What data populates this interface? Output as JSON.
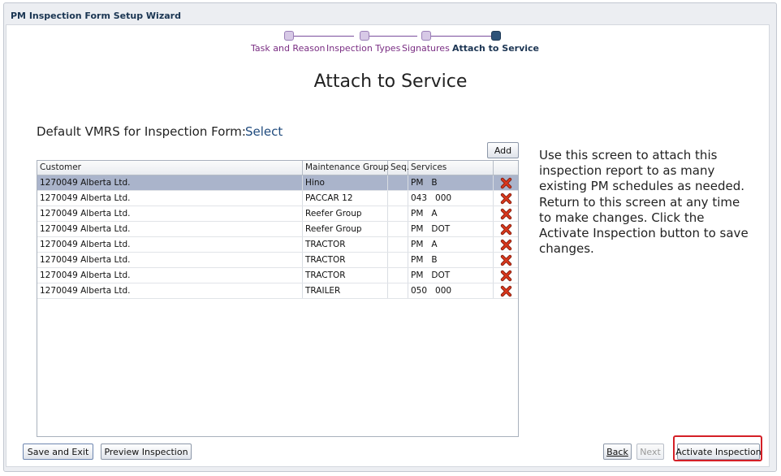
{
  "window": {
    "title": "PM Inspection Form Setup Wizard"
  },
  "wizard": {
    "steps": [
      {
        "label": "Task and Reason",
        "active": false
      },
      {
        "label": "Inspection Types",
        "active": false
      },
      {
        "label": "Signatures",
        "active": false
      },
      {
        "label": "Attach to Service",
        "active": true
      }
    ]
  },
  "page": {
    "heading": "Attach to Service",
    "vmrs_label": "Default VMRS for Inspection Form:",
    "vmrs_link": "Select"
  },
  "table": {
    "add_label": "Add",
    "columns": [
      "Customer",
      "Maintenance Group",
      "Seq.",
      "Services"
    ],
    "rows": [
      {
        "customer": "1270049 Alberta Ltd.",
        "group": "Hino",
        "seq": "",
        "services": "PM   B",
        "selected": true
      },
      {
        "customer": "1270049 Alberta Ltd.",
        "group": "PACCAR 12",
        "seq": "",
        "services": "043   000",
        "selected": false
      },
      {
        "customer": "1270049 Alberta Ltd.",
        "group": "Reefer Group",
        "seq": "",
        "services": "PM   A",
        "selected": false
      },
      {
        "customer": "1270049 Alberta Ltd.",
        "group": "Reefer Group",
        "seq": "",
        "services": "PM   DOT",
        "selected": false
      },
      {
        "customer": "1270049 Alberta Ltd.",
        "group": "TRACTOR",
        "seq": "",
        "services": "PM   A",
        "selected": false
      },
      {
        "customer": "1270049 Alberta Ltd.",
        "group": "TRACTOR",
        "seq": "",
        "services": "PM   B",
        "selected": false
      },
      {
        "customer": "1270049 Alberta Ltd.",
        "group": "TRACTOR",
        "seq": "",
        "services": "PM   DOT",
        "selected": false
      },
      {
        "customer": "1270049 Alberta Ltd.",
        "group": "TRAILER",
        "seq": "",
        "services": "050   000",
        "selected": false
      }
    ],
    "delete_icon": "delete-x-icon"
  },
  "help": {
    "text": "Use this screen to attach this inspection report to as many existing PM schedules as needed. Return to this screen at any time to make changes. Click the Activate Inspection button to save changes."
  },
  "footer": {
    "save_exit": "Save and Exit",
    "preview": "Preview Inspection",
    "back": "Back",
    "next": "Next",
    "activate": "Activate Inspection"
  },
  "colors": {
    "step_label": "#7a2e83",
    "step_active": "#2e5379",
    "selected_row": "#aab4cb",
    "delete_icon": "#d9371c",
    "highlight": "#d42027"
  }
}
